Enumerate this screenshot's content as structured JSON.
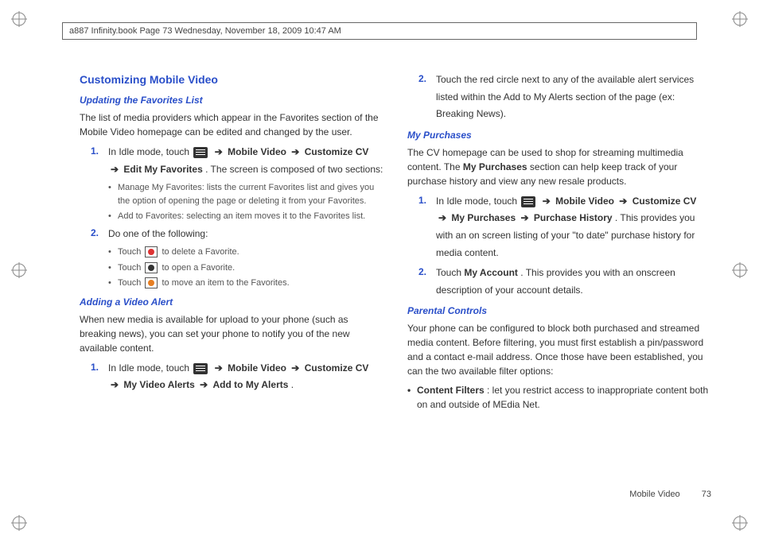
{
  "header": "a887 Infinity.book  Page 73  Wednesday, November 18, 2009  10:47 AM",
  "left": {
    "h2": "Customizing Mobile Video",
    "h3a": "Updating the Favorites List",
    "p1": "The list of media providers which appear in the Favorites section of the Mobile Video homepage can be edited and changed by the user.",
    "s1_num": "1.",
    "s1a": "In Idle mode, touch ",
    "s1b": " Mobile Video ",
    "s1c": " Customize CV ",
    "s1d": " Edit My Favorites",
    "s1e": ". The screen is composed of two sections:",
    "b1": "Manage My Favorites: lists the current Favorites list and gives you the option of opening the page or deleting it from your Favorites.",
    "b2": "Add to Favorites: selecting an item moves it to the Favorites list.",
    "s2_num": "2.",
    "s2": "Do one of the following:",
    "tb1a": "Touch ",
    "tb1b": " to delete a Favorite.",
    "tb2a": "Touch ",
    "tb2b": " to open a Favorite.",
    "tb3a": "Touch ",
    "tb3b": " to move an item to the Favorites.",
    "h3b": "Adding a Video Alert",
    "p2": "When new media is available for upload to your phone (such as breaking news), you can set your phone to notify you of the new available content.",
    "s3_num": "1.",
    "s3a": "In Idle mode, touch ",
    "s3b": " Mobile Video ",
    "s3c": " Customize CV ",
    "s3d": " My Video Alerts ",
    "s3e": " Add to My Alerts",
    "s3f": "."
  },
  "right": {
    "s1_num": "2.",
    "s1": "Touch the red circle next to any of the available alert services listed within the Add to My Alerts section of the page (ex: Breaking News).",
    "h3a": "My Purchases",
    "p1a": "The CV homepage can be used to shop for streaming multimedia content. The ",
    "p1b": "My Purchases",
    "p1c": " section can help keep track of your purchase history and view any new resale products.",
    "s2_num": "1.",
    "s2a": "In Idle mode, touch ",
    "s2b": " Mobile Video ",
    "s2c": " Customize CV ",
    "s2d": " My Purchases ",
    "s2e": " Purchase History",
    "s2f": ". This provides you with an on screen listing of your \"to date\" purchase history for media content.",
    "s3_num": "2.",
    "s3a": "Touch ",
    "s3b": "My Account",
    "s3c": ". This provides you with an onscreen description of your account details.",
    "h3b": "Parental Controls",
    "p2": "Your phone can be configured to block both purchased and streamed media content. Before filtering, you must first establish a pin/password and a contact e-mail address. Once those have been established, you can the two available filter options:",
    "cb1a": "Content Filters",
    "cb1b": ": let you restrict access to inappropriate content both on and outside of MEdia Net."
  },
  "footer": {
    "label": "Mobile Video",
    "page": "73"
  },
  "arrow": "➔"
}
